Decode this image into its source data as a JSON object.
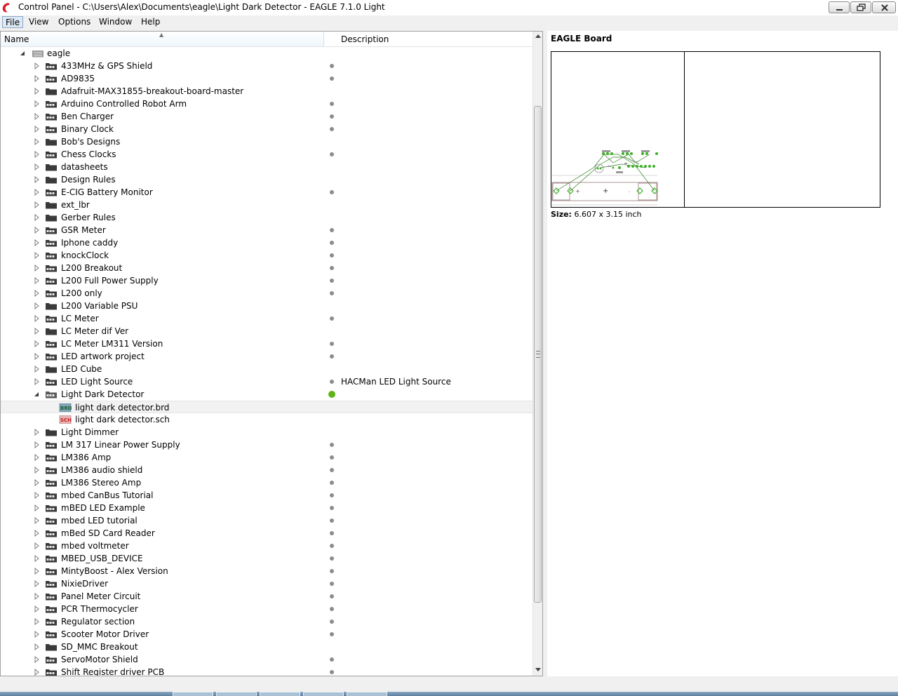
{
  "window": {
    "title": "Control Panel - C:\\Users\\Alex\\Documents\\eagle\\Light Dark Detector - EAGLE 7.1.0 Light"
  },
  "menu": {
    "file": "File",
    "view": "View",
    "options": "Options",
    "window": "Window",
    "help": "Help"
  },
  "tree": {
    "col_name": "Name",
    "col_description": "Description",
    "root_label": "eagle",
    "items": [
      {
        "label": "433MHz & GPS Shield",
        "icon": "project",
        "dot": true
      },
      {
        "label": "AD9835",
        "icon": "project",
        "dot": true
      },
      {
        "label": "Adafruit-MAX31855-breakout-board-master",
        "icon": "folder",
        "dot": false
      },
      {
        "label": "Arduino Controlled Robot Arm",
        "icon": "project",
        "dot": true
      },
      {
        "label": "Ben Charger",
        "icon": "project",
        "dot": true
      },
      {
        "label": "Binary Clock",
        "icon": "project",
        "dot": true
      },
      {
        "label": "Bob's Designs",
        "icon": "folder",
        "dot": false
      },
      {
        "label": "Chess Clocks",
        "icon": "project",
        "dot": true
      },
      {
        "label": "datasheets",
        "icon": "folder",
        "dot": false
      },
      {
        "label": "Design Rules",
        "icon": "folder",
        "dot": false
      },
      {
        "label": "E-CIG Battery Monitor",
        "icon": "project",
        "dot": true
      },
      {
        "label": "ext_lbr",
        "icon": "folder",
        "dot": false
      },
      {
        "label": "Gerber Rules",
        "icon": "folder",
        "dot": false
      },
      {
        "label": "GSR Meter",
        "icon": "project",
        "dot": true
      },
      {
        "label": "Iphone caddy",
        "icon": "project",
        "dot": true
      },
      {
        "label": "knockClock",
        "icon": "project",
        "dot": true
      },
      {
        "label": "L200 Breakout",
        "icon": "project",
        "dot": true
      },
      {
        "label": "L200 Full Power Supply",
        "icon": "project",
        "dot": true
      },
      {
        "label": "L200 only",
        "icon": "project",
        "dot": true
      },
      {
        "label": "L200 Variable PSU",
        "icon": "folder",
        "dot": false
      },
      {
        "label": "LC Meter",
        "icon": "project",
        "dot": true
      },
      {
        "label": "LC Meter dif Ver",
        "icon": "folder",
        "dot": false
      },
      {
        "label": "LC Meter LM311 Version",
        "icon": "project",
        "dot": true
      },
      {
        "label": "LED artwork project",
        "icon": "project",
        "dot": true
      },
      {
        "label": "LED Cube",
        "icon": "folder",
        "dot": false
      },
      {
        "label": "LED Light Source",
        "icon": "project",
        "dot": true,
        "description": "HACMan LED Light Source"
      },
      {
        "label": "Light Dark Detector",
        "icon": "project-open",
        "dot": "active",
        "expanded": true,
        "children": [
          {
            "label": "light dark detector.brd",
            "icon": "brd-file",
            "selected": true
          },
          {
            "label": "light dark detector.sch",
            "icon": "sch-file"
          }
        ]
      },
      {
        "label": "Light Dimmer",
        "icon": "folder",
        "dot": false
      },
      {
        "label": "LM 317 Linear Power Supply",
        "icon": "project",
        "dot": true
      },
      {
        "label": "LM386 Amp",
        "icon": "project",
        "dot": true
      },
      {
        "label": "LM386 audio shield",
        "icon": "project",
        "dot": true
      },
      {
        "label": "LM386 Stereo Amp",
        "icon": "project",
        "dot": true
      },
      {
        "label": "mbed CanBus Tutorial",
        "icon": "project",
        "dot": true
      },
      {
        "label": "mBED LED Example",
        "icon": "project",
        "dot": true
      },
      {
        "label": "mbed LED tutorial",
        "icon": "project",
        "dot": true
      },
      {
        "label": "mBed SD Card Reader",
        "icon": "project",
        "dot": true
      },
      {
        "label": "mbed voltmeter",
        "icon": "project",
        "dot": true
      },
      {
        "label": "MBED_USB_DEVICE",
        "icon": "project",
        "dot": true
      },
      {
        "label": "MintyBoost - Alex Version",
        "icon": "project",
        "dot": true
      },
      {
        "label": "NixieDriver",
        "icon": "project",
        "dot": true
      },
      {
        "label": "Panel Meter Circuit",
        "icon": "project",
        "dot": true
      },
      {
        "label": "PCR Thermocycler",
        "icon": "project",
        "dot": true
      },
      {
        "label": "Regulator section",
        "icon": "project",
        "dot": true
      },
      {
        "label": "Scooter Motor Driver",
        "icon": "project",
        "dot": true
      },
      {
        "label": "SD_MMC Breakout",
        "icon": "folder",
        "dot": false
      },
      {
        "label": "ServoMotor Shield",
        "icon": "project",
        "dot": true
      },
      {
        "label": "Shift Register driver PCB",
        "icon": "project",
        "dot": true
      }
    ]
  },
  "preview": {
    "title": "EAGLE Board",
    "size_label": "Size:",
    "size_value": "6.607 x 3.15 inch"
  },
  "colors": {
    "active_dot": "#5fb319",
    "inactive_dot": "#8c8c8c",
    "trace": "#2e7d1c",
    "pad": "#3fae29"
  }
}
